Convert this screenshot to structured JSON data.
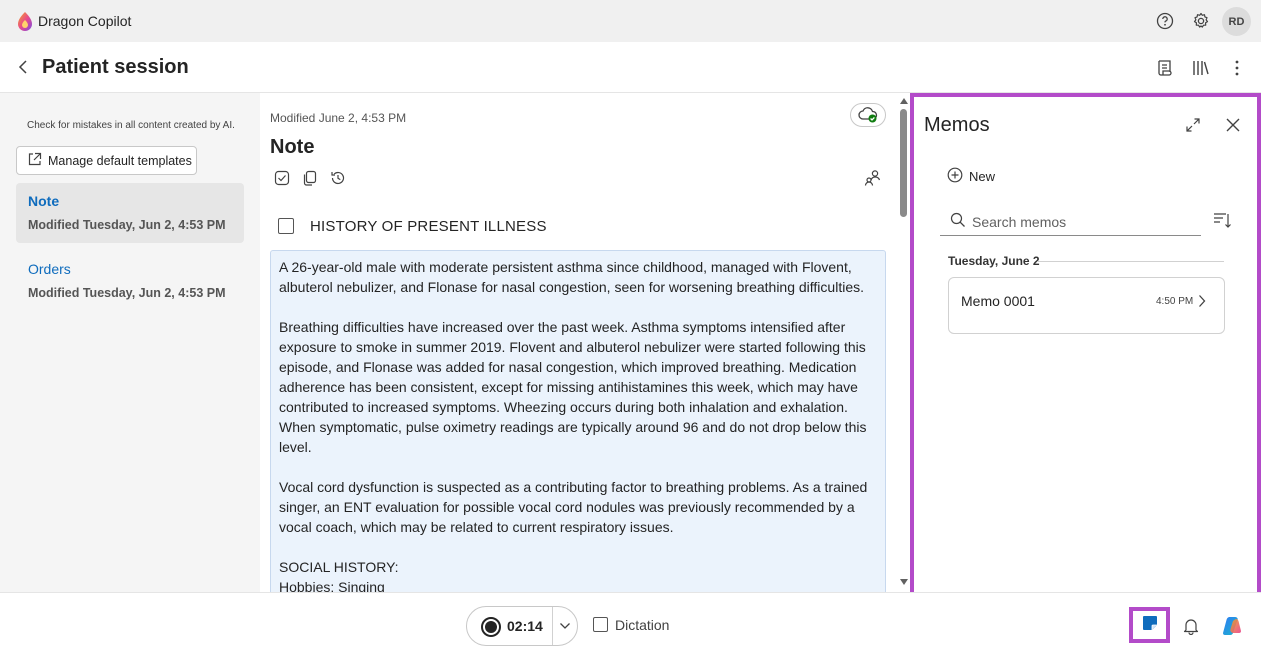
{
  "app": {
    "name": "Dragon Copilot",
    "avatar_initials": "RD",
    "icons": [
      "help-icon",
      "settings-icon"
    ]
  },
  "page": {
    "title": "Patient session",
    "icons": [
      "template-icon",
      "library-icon",
      "more-icon"
    ]
  },
  "sidebar": {
    "disclaimer": "Check for mistakes in all content created by AI.",
    "manage_templates_label": "Manage default templates",
    "items": [
      {
        "label": "Note",
        "sub": "Modified Tuesday, Jun 2, 4:53 PM",
        "active": true
      },
      {
        "label": "Orders",
        "sub": "Modified Tuesday, Jun 2, 4:53 PM",
        "active": false
      }
    ]
  },
  "note": {
    "modified": "Modified June 2, 4:53 PM",
    "title": "Note",
    "section_title": "HISTORY OF PRESENT ILLNESS",
    "paragraphs": [
      "A 26-year-old male with moderate persistent asthma since childhood, managed with Flovent, albuterol nebulizer, and Flonase for nasal congestion, seen for worsening breathing difficulties.",
      "Breathing difficulties have increased over the past week. Asthma symptoms intensified after exposure to smoke in summer 2019. Flovent and albuterol nebulizer were started following this episode, and Flonase was added for nasal congestion, which improved breathing. Medication adherence has been consistent, except for missing antihistamines this week, which may have contributed to increased symptoms. Wheezing occurs during both inhalation and exhalation. When symptomatic, pulse oximetry readings are typically around 96 and do not drop below this level.",
      "Vocal cord dysfunction is suspected as a contributing factor to breathing problems. As a trained singer, an ENT evaluation for possible vocal cord nodules was previously recommended by a vocal coach, which may be related to current respiratory issues.",
      "SOCIAL HISTORY:"
    ],
    "social_line": "Hobbies: Singing"
  },
  "memos": {
    "title": "Memos",
    "new_label": "New",
    "search_placeholder": "Search memos",
    "date_header": "Tuesday, June 2",
    "items": [
      {
        "name": "Memo 0001",
        "time": "4:50 PM"
      }
    ]
  },
  "recorder": {
    "time": "02:14",
    "dictation_label": "Dictation"
  },
  "colors": {
    "accent": "#0f6cbd",
    "highlight": "#b34bc9",
    "note_bg": "#ebf3fc"
  }
}
